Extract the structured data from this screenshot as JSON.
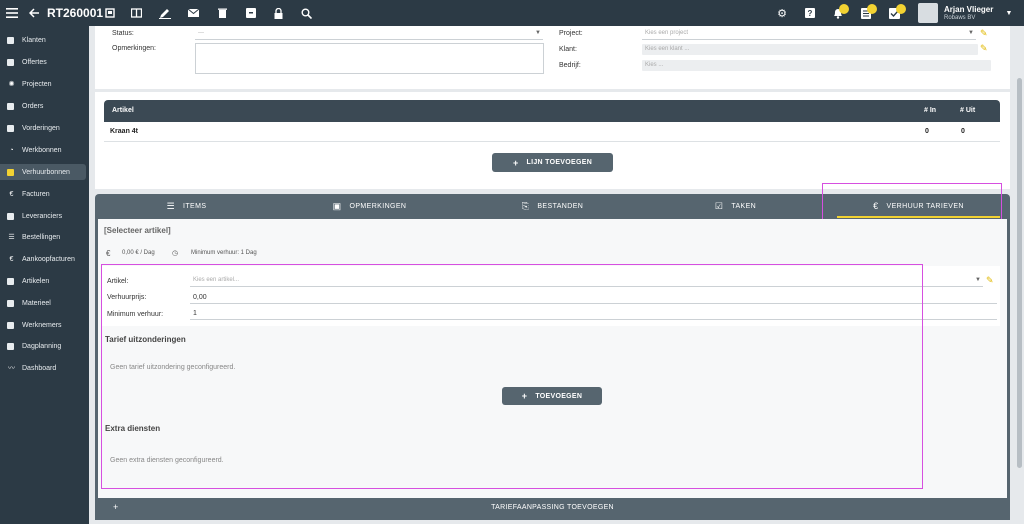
{
  "topbar": {
    "title": "RT260001",
    "user_name": "Arjan Vlieger",
    "user_company": "Robaws BV"
  },
  "sidebar": {
    "items": [
      {
        "label": "Klanten",
        "icon": "clients-icon"
      },
      {
        "label": "Offertes",
        "icon": "quotes-icon"
      },
      {
        "label": "Projecten",
        "icon": "projects-icon"
      },
      {
        "label": "Orders",
        "icon": "orders-icon"
      },
      {
        "label": "Vorderingen",
        "icon": "progress-icon"
      },
      {
        "label": "Werkbonnen",
        "icon": "workorders-icon"
      },
      {
        "label": "Verhuurbonnen",
        "icon": "rental-icon"
      },
      {
        "label": "Facturen",
        "icon": "euro-icon"
      },
      {
        "label": "Leveranciers",
        "icon": "suppliers-icon"
      },
      {
        "label": "Bestellingen",
        "icon": "orders-list-icon"
      },
      {
        "label": "Aankoopfacturen",
        "icon": "euro-icon"
      },
      {
        "label": "Artikelen",
        "icon": "articles-icon"
      },
      {
        "label": "Materieel",
        "icon": "equipment-icon"
      },
      {
        "label": "Werknemers",
        "icon": "employees-icon"
      },
      {
        "label": "Dagplanning",
        "icon": "calendar-icon"
      },
      {
        "label": "Dashboard",
        "icon": "chart-icon"
      }
    ]
  },
  "form": {
    "status_label": "Status:",
    "status_value": "---",
    "opmerkingen_label": "Opmerkingen:",
    "project_label": "Project:",
    "project_placeholder": "Kies een project",
    "klant_label": "Klant:",
    "klant_placeholder": "Kies een klant ...",
    "bedrijf_label": "Bedrijf:",
    "bedrijf_placeholder": "Kies ..."
  },
  "items_table": {
    "headers": {
      "artikel": "Artikel",
      "in": "# In",
      "uit": "# Uit"
    },
    "rows": [
      {
        "artikel": "Kraan 4t",
        "in": "0",
        "uit": "0"
      }
    ],
    "add_line_button": "LIJN TOEVOEGEN"
  },
  "tabs": [
    {
      "label": "ITEMS",
      "icon": "list-icon"
    },
    {
      "label": "OPMERKINGEN",
      "icon": "comment-icon"
    },
    {
      "label": "BESTANDEN",
      "icon": "paperclip-icon"
    },
    {
      "label": "TAKEN",
      "icon": "checkbox-icon"
    },
    {
      "label": "VERHUUR TARIEVEN",
      "icon": "euro-icon"
    }
  ],
  "active_tab": "VERHUUR TARIEVEN",
  "rates": {
    "select_article_title": "[Selecteer artikel]",
    "price_summary": "0,00 € / Dag",
    "min_summary": "Minimum verhuur: 1 Dag",
    "artikel_label": "Artikel:",
    "artikel_placeholder": "Kies een artikel...",
    "prijs_label": "Verhuurprijs:",
    "prijs_value": "0,00",
    "min_label": "Minimum verhuur:",
    "min_value": "1",
    "exceptions_title": "Tarief uitzonderingen",
    "exceptions_empty": "Geen tarief uitzondering geconfigureerd.",
    "add_button": "TOEVOEGEN",
    "extra_title": "Extra diensten",
    "extra_empty": "Geen extra diensten geconfigureerd.",
    "footer_button": "TARIEFAANPASSING TOEVOEGEN"
  },
  "colors": {
    "sidebar_bg": "#2c3a45",
    "accent_yellow": "#f2d232",
    "highlight_magenta": "#d64fe0",
    "table_header": "#3b4954"
  }
}
